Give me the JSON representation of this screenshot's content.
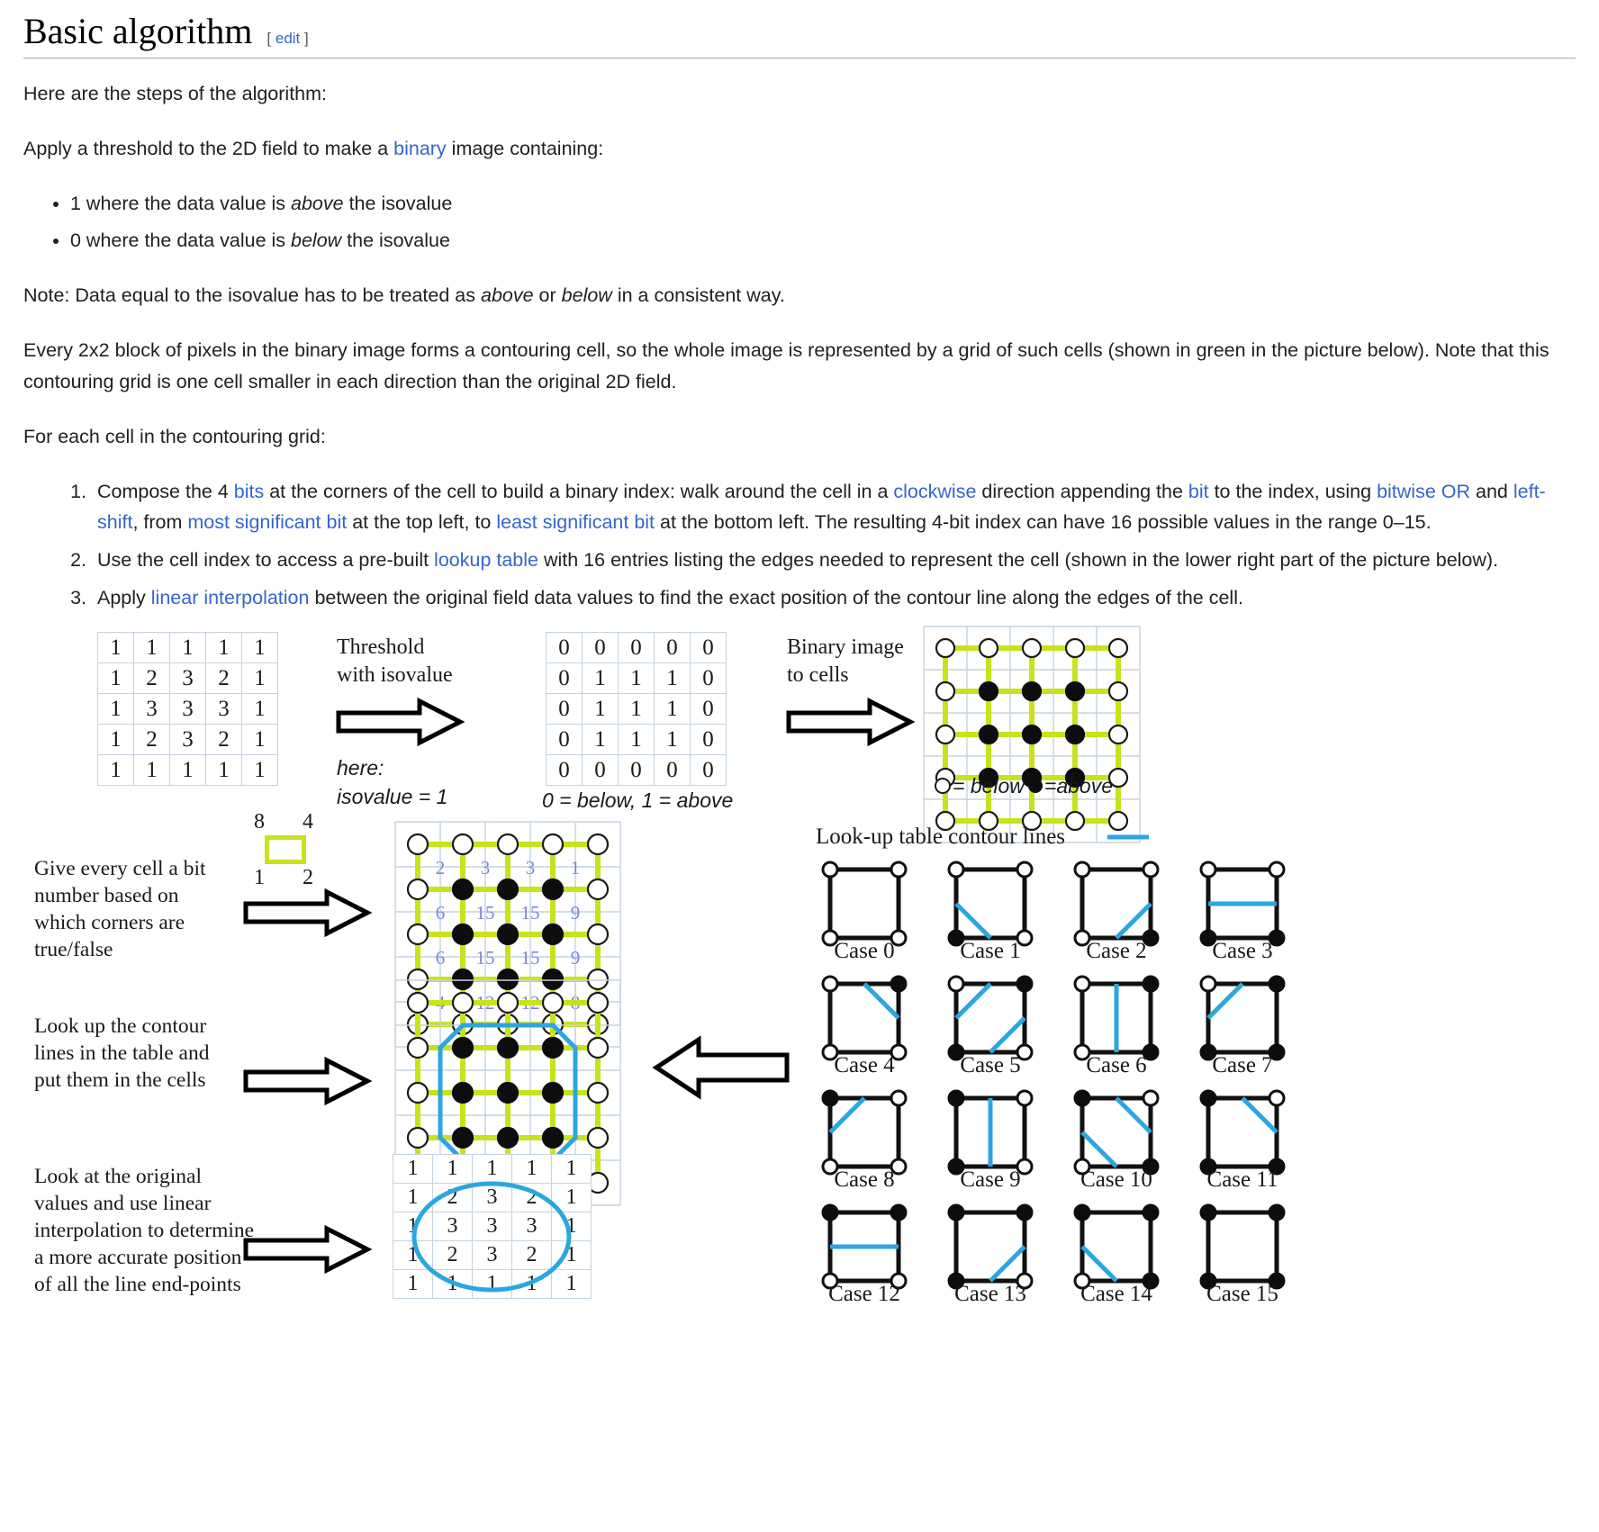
{
  "heading": {
    "title": "Basic algorithm",
    "edit_open": "[",
    "edit_label": "edit",
    "edit_close": "]"
  },
  "intro": "Here are the steps of the algorithm:",
  "threshold_paragraph": {
    "before": "Apply a threshold to the 2D field to make a ",
    "link": "binary",
    "after": " image containing:"
  },
  "bullets": [
    {
      "pre": "1 where the data value is ",
      "em": "above",
      "post": " the isovalue"
    },
    {
      "pre": "0 where the data value is ",
      "em": "below",
      "post": " the isovalue"
    }
  ],
  "note": {
    "pre": "Note: Data equal to the isovalue has to be treated as ",
    "em1": "above",
    "mid": " or ",
    "em2": "below",
    "post": " in a consistent way."
  },
  "cells_paragraph": "Every 2x2 block of pixels in the binary image forms a contouring cell, so the whole image is represented by a grid of such cells (shown in green in the picture below). Note that this contouring grid is one cell smaller in each direction than the original 2D field.",
  "for_each": "For each cell in the contouring grid:",
  "steps": [
    {
      "segments": [
        {
          "t": "Compose the 4 ",
          "link": false
        },
        {
          "t": "bits",
          "link": true
        },
        {
          "t": " at the corners of the cell to build a binary index: walk around the cell in a ",
          "link": false
        },
        {
          "t": "clockwise",
          "link": true
        },
        {
          "t": " direction appending the ",
          "link": false
        },
        {
          "t": "bit",
          "link": true
        },
        {
          "t": " to the index, using ",
          "link": false
        },
        {
          "t": "bitwise OR",
          "link": true
        },
        {
          "t": " and ",
          "link": false
        },
        {
          "t": "left-shift",
          "link": true
        },
        {
          "t": ", from ",
          "link": false
        },
        {
          "t": "most significant bit",
          "link": true
        },
        {
          "t": " at the top left, to ",
          "link": false
        },
        {
          "t": "least significant bit",
          "link": true
        },
        {
          "t": " at the bottom left. The resulting 4-bit index can have 16 possible values in the range 0–15.",
          "link": false
        }
      ]
    },
    {
      "segments": [
        {
          "t": "Use the cell index to access a pre-built ",
          "link": false
        },
        {
          "t": "lookup table",
          "link": true
        },
        {
          "t": " with 16 entries listing the edges needed to represent the cell (shown in the lower right part of the picture below).",
          "link": false
        }
      ]
    },
    {
      "segments": [
        {
          "t": "Apply ",
          "link": false
        },
        {
          "t": "linear interpolation",
          "link": true
        },
        {
          "t": " between the original field data values to find the exact position of the contour line along the edges of the cell.",
          "link": false
        }
      ]
    }
  ],
  "figure": {
    "colors": {
      "green": "#c9e21c",
      "blue": "#2ba6e0",
      "grid_line": "#c3d3e0",
      "node_stroke": "#1a1a1a",
      "link_blue": "#3366cc"
    },
    "field_matrix": {
      "rows": [
        [
          "1",
          "1",
          "1",
          "1",
          "1"
        ],
        [
          "1",
          "2",
          "3",
          "2",
          "1"
        ],
        [
          "1",
          "3",
          "3",
          "3",
          "1"
        ],
        [
          "1",
          "2",
          "3",
          "2",
          "1"
        ],
        [
          "1",
          "1",
          "1",
          "1",
          "1"
        ]
      ]
    },
    "threshold_label_line1": "Threshold",
    "threshold_label_line2": "with isovalue",
    "here_label": "here:",
    "isovalue_label": "isovalue = 1",
    "binary_matrix": {
      "rows": [
        [
          "0",
          "0",
          "0",
          "0",
          "0"
        ],
        [
          "0",
          "1",
          "1",
          "1",
          "0"
        ],
        [
          "0",
          "1",
          "1",
          "1",
          "0"
        ],
        [
          "0",
          "1",
          "1",
          "1",
          "0"
        ],
        [
          "0",
          "0",
          "0",
          "0",
          "0"
        ]
      ],
      "caption": "0 = below, 1 = above"
    },
    "binary_to_cells_line1": "Binary image",
    "binary_to_cells_line2": "to cells",
    "cells_legend_below": "= below",
    "cells_legend_above": "=above",
    "binary_nodes": [
      [
        0,
        0,
        0,
        0,
        0
      ],
      [
        0,
        1,
        1,
        1,
        0
      ],
      [
        0,
        1,
        1,
        1,
        0
      ],
      [
        0,
        1,
        1,
        1,
        0
      ],
      [
        0,
        0,
        0,
        0,
        0
      ]
    ],
    "bit_numbers": {
      "tl": "8",
      "tr": "4",
      "bl": "1",
      "br": "2"
    },
    "step_labels": [
      "Give every cell a bit number based on which corners are true/false",
      "Look up the contour lines in the table and put them in the cells",
      "Look at the original values and use linear interpolation to determine a more accurate position of all the line end-points"
    ],
    "cell_index_values": [
      [
        "2",
        "3",
        "3",
        "1"
      ],
      [
        "6",
        "15",
        "15",
        "9"
      ],
      [
        "6",
        "15",
        "15",
        "9"
      ],
      [
        "4",
        "12",
        "12",
        "8"
      ]
    ],
    "lut_title": "Look-up table contour lines",
    "cases": [
      {
        "label": "Case 0",
        "corners": [
          0,
          0,
          0,
          0
        ],
        "lines": []
      },
      {
        "label": "Case 1",
        "corners": [
          0,
          0,
          0,
          1
        ],
        "lines": [
          [
            0,
            50,
            50,
            100
          ]
        ]
      },
      {
        "label": "Case 2",
        "corners": [
          0,
          0,
          1,
          0
        ],
        "lines": [
          [
            50,
            100,
            100,
            50
          ]
        ]
      },
      {
        "label": "Case 3",
        "corners": [
          0,
          0,
          1,
          1
        ],
        "lines": [
          [
            0,
            50,
            100,
            50
          ]
        ]
      },
      {
        "label": "Case 4",
        "corners": [
          0,
          1,
          0,
          0
        ],
        "lines": [
          [
            50,
            0,
            100,
            50
          ]
        ]
      },
      {
        "label": "Case 5",
        "corners": [
          0,
          1,
          0,
          1
        ],
        "lines": [
          [
            0,
            50,
            50,
            0
          ],
          [
            50,
            100,
            100,
            50
          ]
        ]
      },
      {
        "label": "Case 6",
        "corners": [
          0,
          1,
          1,
          0
        ],
        "lines": [
          [
            50,
            0,
            50,
            100
          ]
        ]
      },
      {
        "label": "Case 7",
        "corners": [
          0,
          1,
          1,
          1
        ],
        "lines": [
          [
            0,
            50,
            50,
            0
          ]
        ]
      },
      {
        "label": "Case 8",
        "corners": [
          1,
          0,
          0,
          0
        ],
        "lines": [
          [
            0,
            50,
            50,
            0
          ]
        ]
      },
      {
        "label": "Case 9",
        "corners": [
          1,
          0,
          0,
          1
        ],
        "lines": [
          [
            50,
            0,
            50,
            100
          ]
        ]
      },
      {
        "label": "Case 10",
        "corners": [
          1,
          0,
          1,
          0
        ],
        "lines": [
          [
            50,
            0,
            100,
            50
          ],
          [
            0,
            50,
            50,
            100
          ]
        ]
      },
      {
        "label": "Case 11",
        "corners": [
          1,
          0,
          1,
          1
        ],
        "lines": [
          [
            50,
            0,
            100,
            50
          ]
        ]
      },
      {
        "label": "Case 12",
        "corners": [
          1,
          1,
          0,
          0
        ],
        "lines": [
          [
            0,
            50,
            100,
            50
          ]
        ]
      },
      {
        "label": "Case 13",
        "corners": [
          1,
          1,
          0,
          1
        ],
        "lines": [
          [
            50,
            100,
            100,
            50
          ]
        ]
      },
      {
        "label": "Case 14",
        "corners": [
          1,
          1,
          1,
          0
        ],
        "lines": [
          [
            0,
            50,
            50,
            100
          ]
        ]
      },
      {
        "label": "Case 15",
        "corners": [
          1,
          1,
          1,
          1
        ],
        "lines": []
      }
    ],
    "interp_matrix": {
      "rows": [
        [
          "1",
          "1",
          "1",
          "1",
          "1"
        ],
        [
          "1",
          "2",
          "3",
          "2",
          "1"
        ],
        [
          "1",
          "3",
          "3",
          "3",
          "1"
        ],
        [
          "1",
          "2",
          "3",
          "2",
          "1"
        ],
        [
          "1",
          "1",
          "1",
          "1",
          "1"
        ]
      ]
    }
  }
}
